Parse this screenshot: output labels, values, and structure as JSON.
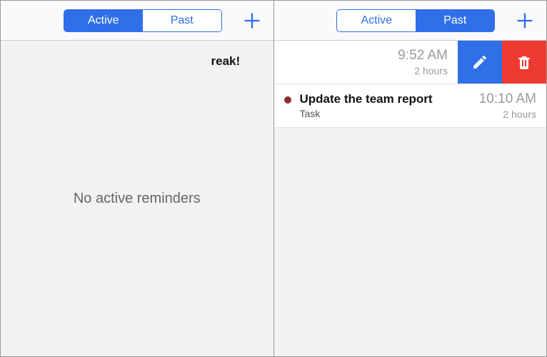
{
  "tabs": {
    "active": "Active",
    "past": "Past"
  },
  "left": {
    "selected": "active",
    "empty_text": "No active reminders"
  },
  "right": {
    "selected": "past",
    "rows": [
      {
        "title": "reak!",
        "subtitle": "",
        "time": "9:52 AM",
        "duration": "2 hours",
        "swiped": true,
        "dot": false
      },
      {
        "title": "Update the team report",
        "subtitle": "Task",
        "time": "10:10 AM",
        "duration": "2 hours",
        "swiped": false,
        "dot": true
      }
    ]
  },
  "icons": {
    "add": "add-icon",
    "edit": "pencil-icon",
    "delete": "trash-icon"
  }
}
